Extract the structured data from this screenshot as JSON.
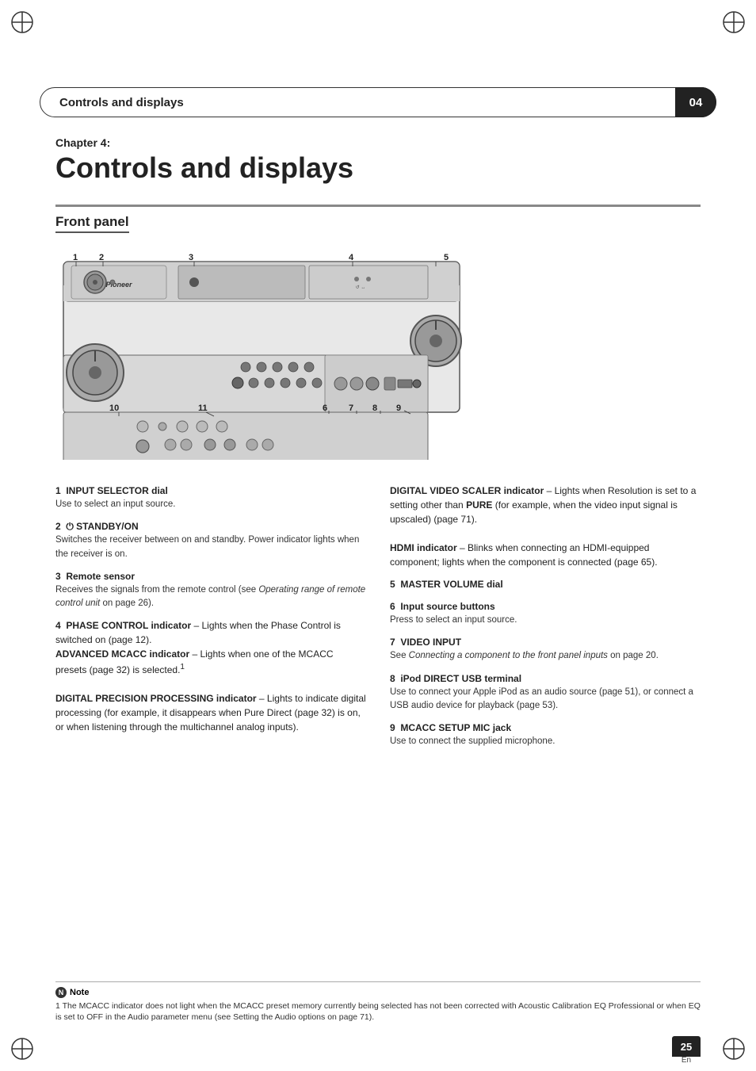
{
  "header": {
    "title": "Controls and displays",
    "chapter_badge": "04"
  },
  "chapter": {
    "sub": "Chapter 4:",
    "main": "Controls and displays"
  },
  "front_panel": {
    "heading": "Front panel"
  },
  "items_left": [
    {
      "num": "1",
      "title": "INPUT SELECTOR dial",
      "body": "Use to select an input source."
    },
    {
      "num": "2",
      "title": "⏻ STANDBY/ON",
      "body": "Switches the receiver between on and standby. Power indicator lights when the receiver is on."
    },
    {
      "num": "3",
      "title": "Remote sensor",
      "body": "Receives the signals from the remote control (see Operating range of remote control unit on page 26)."
    },
    {
      "num": "4",
      "title_parts": [
        {
          "text": "PHASE CONTROL indicator",
          "bold": true
        },
        {
          "text": " – Lights when the Phase Control is switched on (page 12).",
          "bold": false
        },
        {
          "text": "ADVANCED MCACC indicator",
          "bold": true
        },
        {
          "text": " – Lights when one of the MCACC presets (page 32) is selected.",
          "bold": false,
          "sup": "1"
        },
        {
          "text": "DIGITAL PRECISION PROCESSING indicator",
          "bold": true
        },
        {
          "text": " – Lights to indicate digital processing (for example, it disappears when Pure Direct (page 32) is on, or when listening through the multichannel analog inputs).",
          "bold": false
        }
      ]
    }
  ],
  "items_right": [
    {
      "title_parts": [
        {
          "text": "DIGITAL VIDEO SCALER indicator",
          "bold": true
        },
        {
          "text": " – Lights when Resolution is set to a setting other than ",
          "bold": false
        },
        {
          "text": "PURE",
          "bold": true
        },
        {
          "text": " (for example, when the video input signal is upscaled) (page 71).",
          "bold": false
        }
      ]
    },
    {
      "title_parts": [
        {
          "text": "HDMI indicator",
          "bold": true
        },
        {
          "text": " – Blinks when connecting an HDMI-equipped component; lights when the component is connected (page 65).",
          "bold": false
        }
      ]
    },
    {
      "num": "5",
      "title": "MASTER VOLUME dial",
      "body": ""
    },
    {
      "num": "6",
      "title": "Input source buttons",
      "body": "Press to select an input source."
    },
    {
      "num": "7",
      "title": "VIDEO INPUT",
      "body_italic": "See Connecting a component to the front panel inputs",
      "body_after": " on page 20."
    },
    {
      "num": "8",
      "title": "iPod DIRECT USB terminal",
      "body": "Use to connect your Apple iPod as an audio source (page 51), or connect a USB audio device for playback (page 53)."
    },
    {
      "num": "9",
      "title": "MCACC SETUP MIC jack",
      "body": "Use to connect the supplied microphone."
    }
  ],
  "note": {
    "label": "Note",
    "footnote": "1  The MCACC indicator does not light when the MCACC preset memory currently being selected has not been corrected with Acoustic Calibration EQ Professional or when EQ is set to OFF in the Audio parameter menu (see Setting the Audio options on page 71)."
  },
  "page": {
    "number": "25",
    "lang": "En"
  }
}
